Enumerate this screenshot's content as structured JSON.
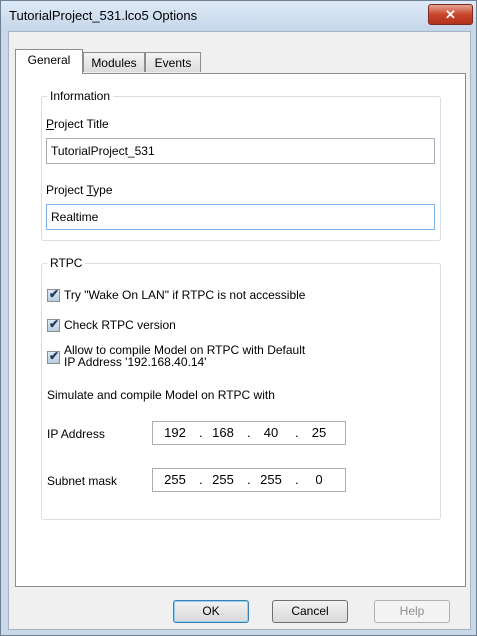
{
  "window": {
    "title": "TutorialProject_531.lco5 Options",
    "close_symbol": "✕"
  },
  "tabs": [
    {
      "label": "General",
      "active": true
    },
    {
      "label": "Modules",
      "active": false
    },
    {
      "label": "Events",
      "active": false
    }
  ],
  "information": {
    "legend": "Information",
    "project_title_label": "Project Title",
    "project_title_value": "TutorialProject_531",
    "project_type_label": "Project Type",
    "project_type_value": "Realtime"
  },
  "rtpc": {
    "legend": "RTPC",
    "checkboxes": [
      {
        "label": "Try \"Wake On LAN\" if RTPC is not accessible",
        "checked": true
      },
      {
        "label": "Check RTPC version",
        "checked": true
      },
      {
        "label_line1": "Allow to compile Model on RTPC with Default",
        "label_line2": "IP Address '192.168.40.14'",
        "checked": true
      }
    ],
    "simulate_label": "Simulate and compile Model on RTPC with",
    "ip_label": "IP Address",
    "ip_octets": [
      "192",
      "168",
      "40",
      "25"
    ],
    "subnet_label": "Subnet mask",
    "subnet_octets": [
      "255",
      "255",
      "255",
      "0"
    ],
    "dot": "."
  },
  "buttons": {
    "ok": "OK",
    "cancel": "Cancel",
    "help": "Help"
  },
  "colors": {
    "accent": "#3c7fb1",
    "close": "#c8452b"
  }
}
